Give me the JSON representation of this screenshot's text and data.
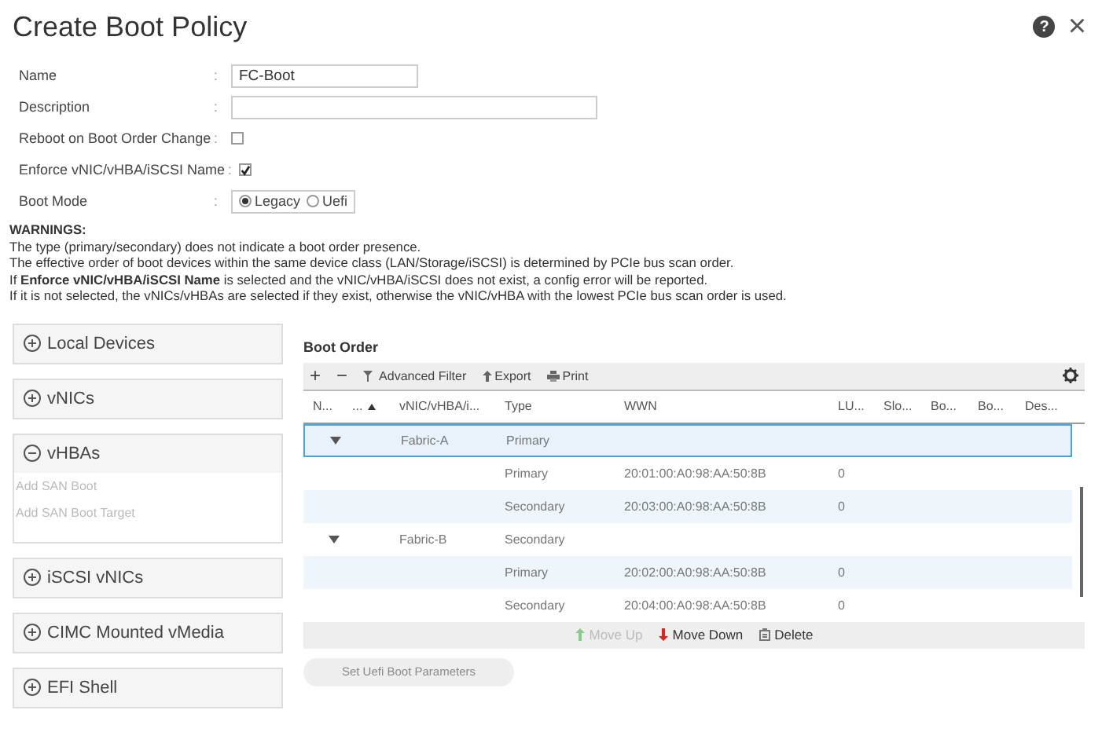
{
  "window": {
    "title": "Create Boot Policy",
    "help": "?",
    "close": "×"
  },
  "form": {
    "name_label": "Name",
    "name_value": "FC-Boot",
    "description_label": "Description",
    "reboot_label": "Reboot on Boot Order Change",
    "reboot_checked": false,
    "enforce_label": "Enforce vNIC/vHBA/iSCSI Name",
    "enforce_checked": true,
    "boot_mode_label": "Boot Mode",
    "separator": ":",
    "boot_modes": [
      {
        "label": "Legacy",
        "selected": true
      },
      {
        "label": "Uefi",
        "selected": false
      }
    ]
  },
  "warnings": {
    "heading": "WARNINGS:",
    "lines": [
      "The type (primary/secondary) does not indicate a boot order presence.",
      "The effective order of boot devices within the same device class (LAN/Storage/iSCSI) is determined by PCIe bus scan order.",
      "If **Enforce vNIC/vHBA/iSCSI Name** is selected and the vNIC/vHBA/iSCSI does not exist, a config error will be reported.",
      "If it is not selected, the vNICs/vHBAs are selected if they exist, otherwise the vNIC/vHBA with the lowest PCIe bus scan order is used."
    ]
  },
  "sidebar": {
    "sections": [
      {
        "label": "Local Devices",
        "expanded": false
      },
      {
        "label": "vNICs",
        "expanded": false
      },
      {
        "label": "vHBAs",
        "expanded": true,
        "items": [
          {
            "label": "Add SAN Boot",
            "disabled": true
          },
          {
            "label": "Add SAN Boot Target",
            "disabled": true
          }
        ]
      },
      {
        "label": "iSCSI vNICs",
        "expanded": false
      },
      {
        "label": "CIMC Mounted vMedia",
        "expanded": false
      },
      {
        "label": "EFI Shell",
        "expanded": false
      }
    ]
  },
  "boot_order": {
    "title": "Boot Order",
    "toolbar": {
      "add": "+",
      "remove": "−",
      "filter": "Advanced Filter",
      "export": "Export",
      "print": "Print"
    },
    "columns": [
      "N...",
      "...",
      "vNIC/vHBA/i...",
      "Type",
      "WWN",
      "LU...",
      "Slo...",
      "Bo...",
      "Bo...",
      "Des..."
    ],
    "rows": [
      {
        "kind": "group",
        "selected": true,
        "name": "Fabric-A",
        "type": "Primary"
      },
      {
        "kind": "target",
        "selected": false,
        "type": "Primary",
        "wwn": "20:01:00:A0:98:AA:50:8B",
        "lun": "0"
      },
      {
        "kind": "target",
        "selected": false,
        "type": "Secondary",
        "wwn": "20:03:00:A0:98:AA:50:8B",
        "lun": "0"
      },
      {
        "kind": "group",
        "selected": false,
        "name": "Fabric-B",
        "type": "Secondary"
      },
      {
        "kind": "target",
        "selected": false,
        "type": "Primary",
        "wwn": "20:02:00:A0:98:AA:50:8B",
        "lun": "0"
      },
      {
        "kind": "target",
        "selected": false,
        "type": "Secondary",
        "wwn": "20:04:00:A0:98:AA:50:8B",
        "lun": "0"
      }
    ],
    "actions": [
      {
        "kind": "up",
        "label": "Move Up",
        "disabled": true
      },
      {
        "kind": "down",
        "label": "Move Down",
        "disabled": false
      },
      {
        "kind": "delete",
        "label": "Delete",
        "disabled": false
      }
    ],
    "uefi_button": {
      "label": "Set Uefi Boot Parameters",
      "disabled": true
    }
  }
}
